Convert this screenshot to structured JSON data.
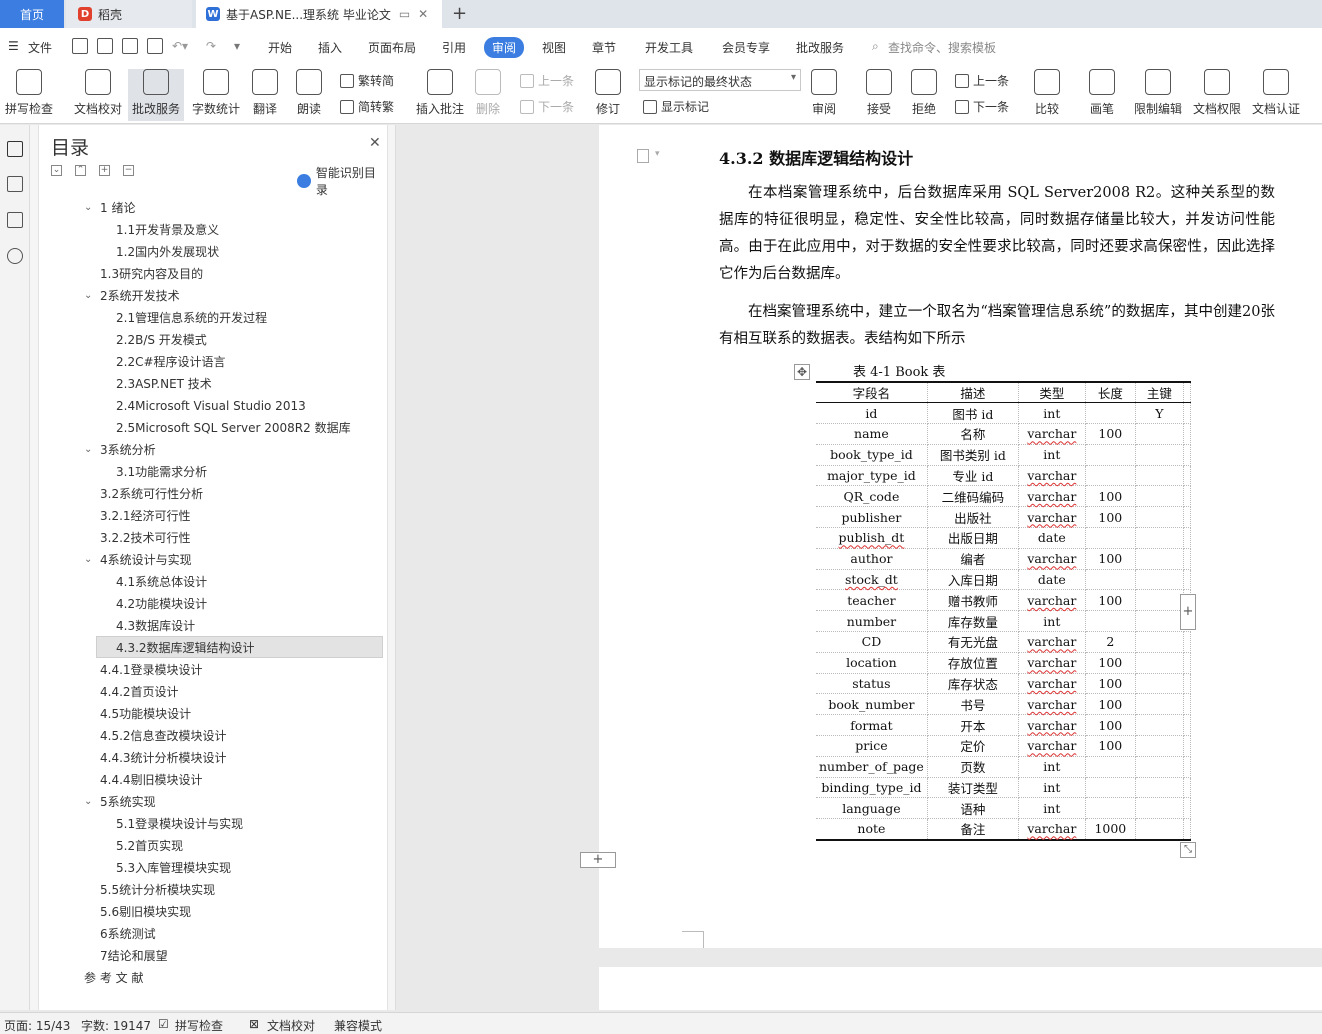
{
  "tabs": {
    "home": "首页",
    "daoke": "稻壳",
    "doc": "基于ASP.NE...理系统 毕业论文"
  },
  "menu": {
    "file": "文件",
    "items": [
      "开始",
      "插入",
      "页面布局",
      "引用",
      "审阅",
      "视图",
      "章节",
      "开发工具",
      "会员专享",
      "批改服务"
    ],
    "search": "查找命令、搜索模板"
  },
  "ribbon": {
    "spellcheck": "拼写检查",
    "doc_proof": "文档校对",
    "correction": "批改服务",
    "word_count": "字数统计",
    "translate": "翻译",
    "read_aloud": "朗读",
    "to_simplified": "繁转简",
    "to_traditional": "简转繁",
    "insert_comment": "插入批注",
    "delete": "删除",
    "prev_comment": "上一条",
    "next_comment": "下一条",
    "revise": "修订",
    "show_select": "显示标记的最终状态",
    "show_marks": "显示标记",
    "review": "审阅",
    "accept": "接受",
    "reject": "拒绝",
    "prev_change": "上一条",
    "next_change": "下一条",
    "compare": "比较",
    "pen": "画笔",
    "restrict": "限制编辑",
    "doc_rights": "文档权限",
    "doc_auth": "文档认证"
  },
  "toc": {
    "title": "目录",
    "smart": "智能识别目录",
    "items": [
      {
        "label": "1 绪论",
        "level": 1,
        "expanded": true
      },
      {
        "label": "1.1开发背景及意义",
        "level": 2
      },
      {
        "label": "1.2国内外发展现状",
        "level": 2
      },
      {
        "label": "1.3研究内容及目的",
        "level": 1
      },
      {
        "label": "2系统开发技术",
        "level": 1,
        "expanded": true
      },
      {
        "label": "2.1管理信息系统的开发过程",
        "level": 2
      },
      {
        "label": "2.2B/S 开发模式",
        "level": 2
      },
      {
        "label": "2.2C#程序设计语言",
        "level": 2
      },
      {
        "label": "2.3ASP.NET 技术",
        "level": 2
      },
      {
        "label": "2.4Microsoft Visual Studio 2013",
        "level": 2
      },
      {
        "label": "2.5Microsoft SQL Server 2008R2 数据库",
        "level": 2
      },
      {
        "label": "3系统分析",
        "level": 1,
        "expanded": true
      },
      {
        "label": "3.1功能需求分析",
        "level": 2
      },
      {
        "label": "3.2系统可行性分析",
        "level": 1
      },
      {
        "label": "3.2.1经济可行性",
        "level": 1
      },
      {
        "label": "3.2.2技术可行性",
        "level": 1
      },
      {
        "label": "4系统设计与实现",
        "level": 1,
        "expanded": true
      },
      {
        "label": "4.1系统总体设计",
        "level": 2
      },
      {
        "label": "4.2功能模块设计",
        "level": 2
      },
      {
        "label": "4.3数据库设计",
        "level": 2
      },
      {
        "label": "4.3.2数据库逻辑结构设计",
        "level": 2,
        "selected": true
      },
      {
        "label": "4.4.1登录模块设计",
        "level": 1
      },
      {
        "label": "4.4.2首页设计",
        "level": 1
      },
      {
        "label": "4.5功能模块设计",
        "level": 1
      },
      {
        "label": "4.5.2信息查改模块设计",
        "level": 1
      },
      {
        "label": "4.4.3统计分析模块设计",
        "level": 1
      },
      {
        "label": "4.4.4剔旧模块设计",
        "level": 1
      },
      {
        "label": "5系统实现",
        "level": 1,
        "expanded": true
      },
      {
        "label": "5.1登录模块设计与实现",
        "level": 2
      },
      {
        "label": "5.2首页实现",
        "level": 2
      },
      {
        "label": "5.3入库管理模块实现",
        "level": 2
      },
      {
        "label": "5.5统计分析模块实现",
        "level": 1
      },
      {
        "label": "5.6剔旧模块实现",
        "level": 1
      },
      {
        "label": "6系统测试",
        "level": 1
      },
      {
        "label": "7结论和展望",
        "level": 1
      },
      {
        "label": "参 考 文 献",
        "level": 0
      }
    ]
  },
  "doc": {
    "heading": "4.3.2   数据库逻辑结构设计",
    "para1": "在本档案管理系统中，后台数据库采用 SQL Server2008 R2。这种关系型的数据库的特征很明显，稳定性、安全性比较高，同时数据存储量比较大，并发访问性能高。由于在此应用中，对于数据的安全性要求比较高，同时还要求高保密性，因此选择它作为后台数据库。",
    "para2": "在档案管理系统中，建立一个取名为“档案管理信息系统”的数据库，其中创建20张有相互联系的数据表。表结构如下所示",
    "table_caption": "表 4-1 Book 表",
    "table_headers": [
      "字段名",
      "描述",
      "类型",
      "长度",
      "主键"
    ],
    "table_rows": [
      [
        "id",
        "图书 id",
        "int",
        "",
        "Y"
      ],
      [
        "name",
        "名称",
        "varchar",
        "100",
        ""
      ],
      [
        "book_type_id",
        "图书类别 id",
        "int",
        "",
        ""
      ],
      [
        "major_type_id",
        "专业 id",
        "varchar",
        "",
        ""
      ],
      [
        "QR_code",
        "二维码编码",
        "varchar",
        "100",
        ""
      ],
      [
        "publisher",
        "出版社",
        "varchar",
        "100",
        ""
      ],
      [
        "publish_dt",
        "出版日期",
        "date",
        "",
        ""
      ],
      [
        "author",
        "编者",
        "varchar",
        "100",
        ""
      ],
      [
        "stock_dt",
        "入库日期",
        "date",
        "",
        ""
      ],
      [
        "teacher",
        "赠书教师",
        "varchar",
        "100",
        ""
      ],
      [
        "number",
        "库存数量",
        "int",
        "",
        ""
      ],
      [
        "CD",
        "有无光盘",
        "varchar",
        "2",
        ""
      ],
      [
        "location",
        "存放位置",
        "varchar",
        "100",
        ""
      ],
      [
        "status",
        "库存状态",
        "varchar",
        "100",
        ""
      ],
      [
        "book_number",
        "书号",
        "varchar",
        "100",
        ""
      ],
      [
        "format",
        "开本",
        "varchar",
        "100",
        ""
      ],
      [
        "price",
        "定价",
        "varchar",
        "100",
        ""
      ],
      [
        "number_of_page",
        "页数",
        "int",
        "",
        ""
      ],
      [
        "binding_type_id",
        "装订类型",
        "int",
        "",
        ""
      ],
      [
        "language",
        "语种",
        "int",
        "",
        ""
      ],
      [
        "note",
        "备注",
        "varchar",
        "1000",
        ""
      ]
    ]
  },
  "status": {
    "page": "页面: 15/43",
    "words": "字数: 19147",
    "spell": "拼写检查",
    "proof": "文档校对",
    "compat": "兼容模式"
  },
  "colors": {
    "accent": "#3b7de0",
    "daoke_logo": "#e0402c"
  }
}
